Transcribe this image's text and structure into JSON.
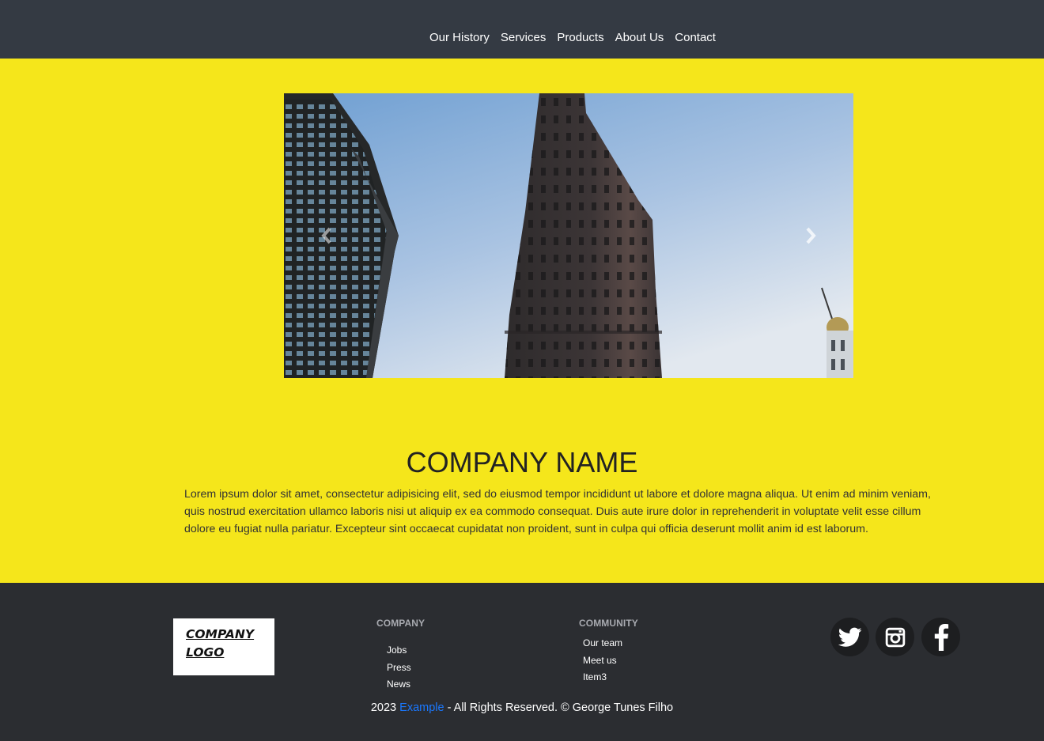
{
  "nav": {
    "items": [
      "Our History",
      "Services",
      "Products",
      "About Us",
      "Contact"
    ]
  },
  "carousel": {
    "prev_icon": "chevron-left-icon",
    "next_icon": "chevron-right-icon"
  },
  "hero": {
    "title": "COMPANY NAME",
    "body": "Lorem ipsum dolor sit amet, consectetur adipisicing elit, sed do eiusmod tempor incididunt ut labore et dolore magna aliqua. Ut enim ad minim veniam, quis nostrud exercitation ullamco laboris nisi ut aliquip ex ea commodo consequat. Duis aute irure dolor in reprehenderit in voluptate velit esse cillum dolore eu fugiat nulla pariatur. Excepteur sint occaecat cupidatat non proident, sunt in culpa qui officia deserunt mollit anim id est laborum.",
    "background_color": "#f5e61b"
  },
  "footer": {
    "logo_line1": "COMPANY",
    "logo_line2": "LOGO",
    "company": {
      "heading": "COMPANY",
      "links": [
        "Jobs",
        "Press",
        "News"
      ]
    },
    "community": {
      "heading": "COMMUNITY",
      "links": [
        "Our team",
        "Meet us",
        "Item3"
      ]
    },
    "social": [
      "twitter-icon",
      "instagram-icon",
      "facebook-icon"
    ],
    "copyright_prefix": "2023",
    "copyright_link": "Example",
    "copyright_suffix": "- All Rights Reserved. © George Tunes Filho",
    "link_color": "#1a78ff"
  }
}
